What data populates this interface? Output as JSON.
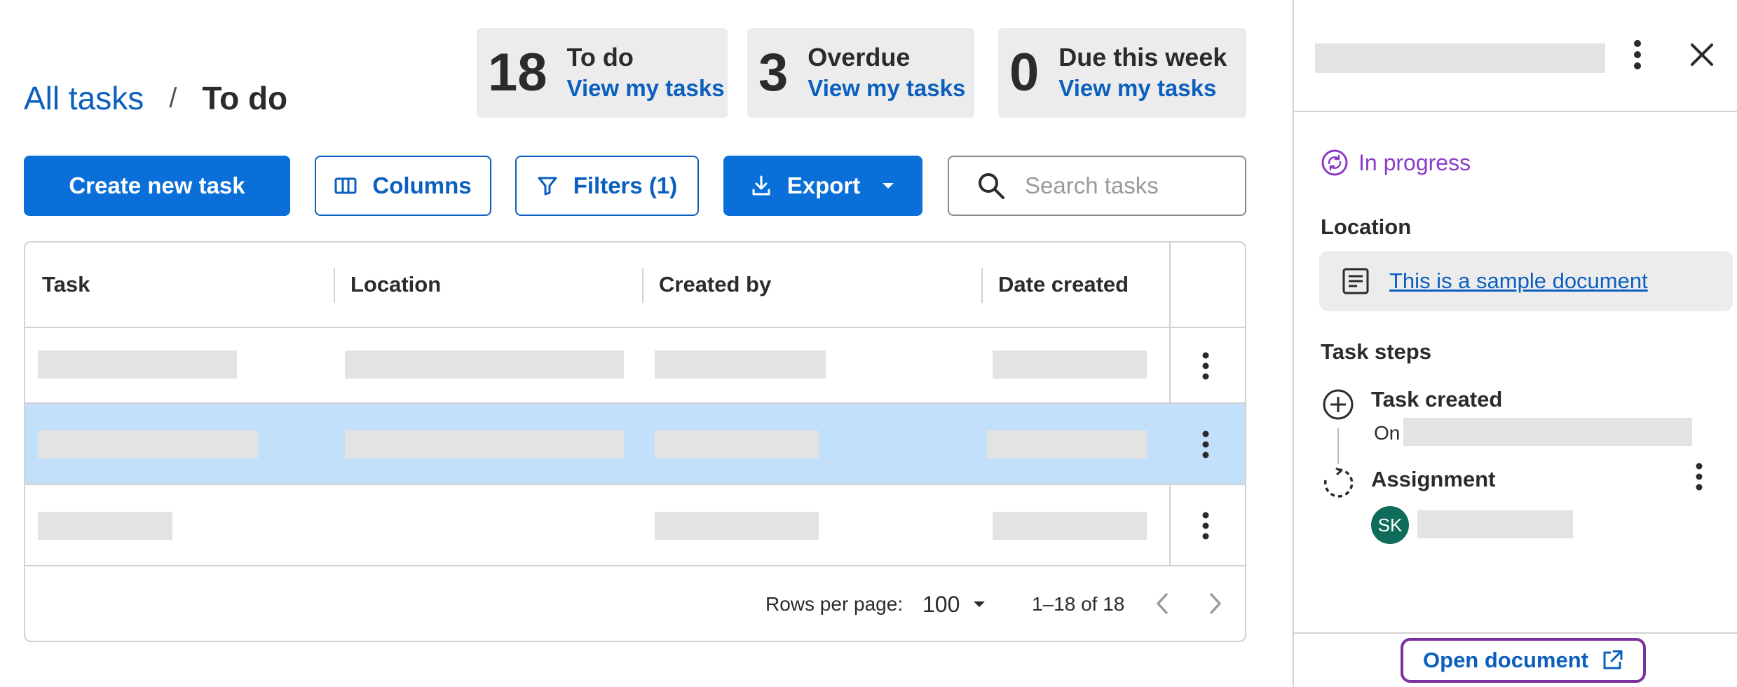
{
  "breadcrumb": {
    "parent": "All tasks",
    "separator": "/",
    "current": "To do"
  },
  "stats": [
    {
      "number": "18",
      "label": "To do",
      "link": "View my tasks"
    },
    {
      "number": "3",
      "label": "Overdue",
      "link": "View my tasks"
    },
    {
      "number": "0",
      "label": "Due this week",
      "link": "View my tasks"
    }
  ],
  "toolbar": {
    "create_label": "Create new task",
    "columns_label": "Columns",
    "filters_label": "Filters (1)",
    "export_label": "Export",
    "search_placeholder": "Search tasks"
  },
  "table": {
    "columns": [
      "Task",
      "Location",
      "Created by",
      "Date created"
    ],
    "selected_row": 1
  },
  "pagination": {
    "rows_label": "Rows per page:",
    "rows_value": "100",
    "range": "1–18 of 18"
  },
  "panel": {
    "status": "In progress",
    "location_title": "Location",
    "document_link": "This is a sample document",
    "steps_title": "Task steps",
    "step1_title": "Task created",
    "step1_prefix": "On",
    "step2_title": "Assignment",
    "assignee_initials": "SK",
    "open_button": "Open document"
  },
  "colors": {
    "primary": "#0a6fd8",
    "link": "#0b5fbf",
    "status": "#8b3cc7",
    "selected_row": "#c3e0fb",
    "avatar": "#0f6b5a",
    "focus_ring": "#7a2f9e"
  }
}
